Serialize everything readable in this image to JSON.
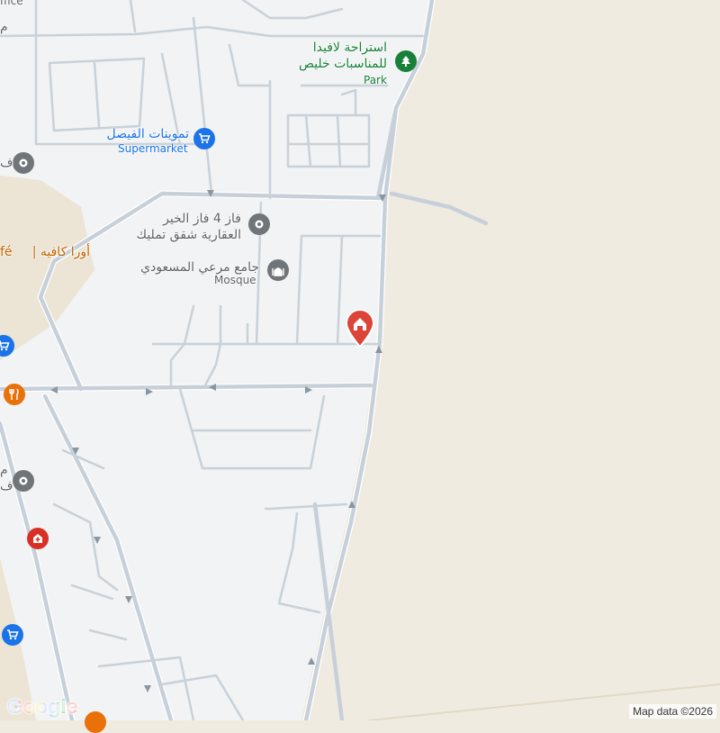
{
  "map": {
    "colors": {
      "desert": "#f0ebe1",
      "urban": "#f1f3f4",
      "road": "#c7d0d9",
      "road_outline": "#ffffff",
      "poi_blue": "#1a73e8",
      "poi_gray": "#70757a",
      "poi_green": "#188038",
      "poi_orange": "#e8710a",
      "poi_red": "#d93025",
      "marker_red": "#db4437"
    },
    "labels": {
      "top_edge_fragment": "ffice",
      "left_edge_fragment": "م",
      "park_name_line1": "استراحة لافيدا",
      "park_name_line2": "للمناسبات خليص",
      "park_type": "Park",
      "supermarket_name": "تموينات الفيصل",
      "supermarket_type": "Supermarket",
      "fragment_left_1": "ف",
      "realestate_line1": "فاز 4 فاز الخير",
      "realestate_line2": "العقارية شقق تمليك",
      "cafe_name_ar": "أورا كافيه |",
      "cafe_name_en_fragment": "fé",
      "mosque_name": "جامع مرعي المسعودي",
      "mosque_type": "Mosque",
      "fragment_left_2": "ف",
      "fragment_left_3": "م"
    },
    "icons": {
      "park": "tree-icon",
      "supermarket": "shopping-cart-icon",
      "generic_place": "place-icon",
      "mosque": "mosque-icon",
      "restaurant": "fork-knife-icon",
      "hospital": "hospital-cross-icon",
      "marker": "home-marker-icon"
    },
    "google_logo": "Google",
    "attribution": "Map data ©2026"
  }
}
